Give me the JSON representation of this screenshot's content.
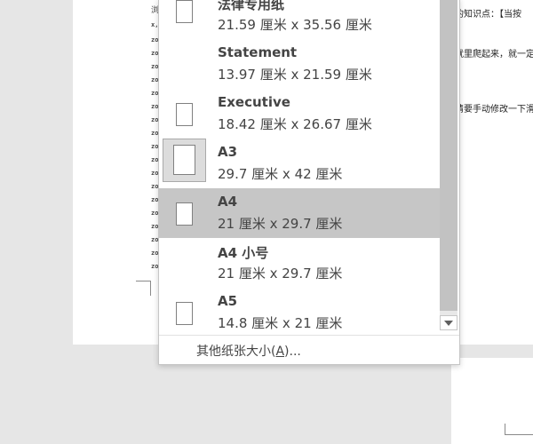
{
  "document": {
    "right_lines": [
      "的知识点：【当按",
      "就里爬起来，就一定",
      "请要手动修改一下滑"
    ],
    "left_marks": [
      "浏",
      "x,",
      "zo",
      "zo",
      "zo",
      "zo",
      "zo",
      "zo",
      "zo",
      "zo",
      "zo",
      "zo",
      "zo",
      "zo",
      "zo",
      "zo",
      "zo",
      "zo",
      "zo",
      "zo"
    ]
  },
  "paper_size_menu": {
    "items": [
      {
        "name": "法律专用纸",
        "size": "21.59 厘米 x 35.56 厘米",
        "has_thumb": true
      },
      {
        "name": "Statement",
        "size": "13.97 厘米 x 21.59 厘米",
        "has_thumb": false
      },
      {
        "name": "Executive",
        "size": "18.42 厘米 x 26.67 厘米",
        "has_thumb": true
      },
      {
        "name": "A3",
        "size": "29.7 厘米 x 42 厘米",
        "has_thumb": true
      },
      {
        "name": "A4",
        "size": "21 厘米 x 29.7 厘米",
        "has_thumb": true
      },
      {
        "name": "A4 小号",
        "size": "21 厘米 x 29.7 厘米",
        "has_thumb": false
      },
      {
        "name": "A5",
        "size": "14.8 厘米 x 21 厘米",
        "has_thumb": true
      }
    ],
    "hovered": "A3",
    "selected": "A4",
    "more_sizes_prefix": "其他纸张大小(",
    "more_sizes_key": "A",
    "more_sizes_suffix": ")..."
  }
}
